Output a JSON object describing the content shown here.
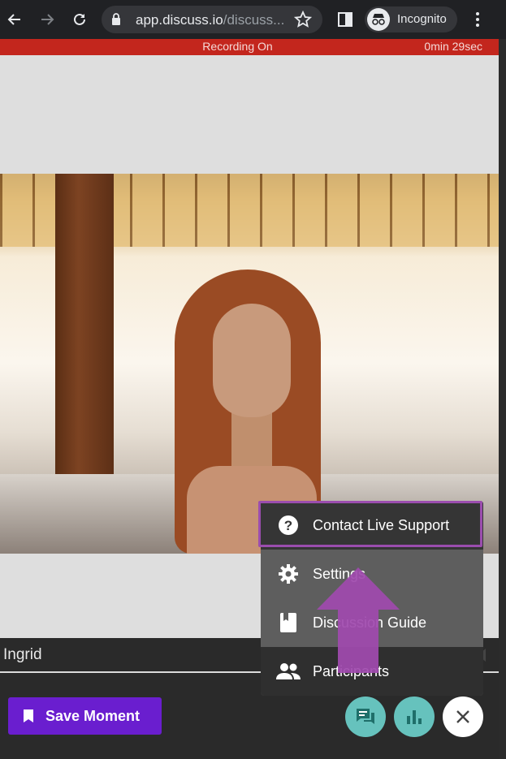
{
  "browser": {
    "url_host": "app.discuss.io",
    "url_path": "/discuss...",
    "incognito_label": "Incognito"
  },
  "recording": {
    "status": "Recording On",
    "timer": "0min 29sec",
    "color": "#c3261d"
  },
  "participant": {
    "name": "Ingrid"
  },
  "menu": {
    "items": [
      {
        "label": "Contact Live Support",
        "icon": "help-circle-icon"
      },
      {
        "label": "Settings",
        "icon": "gear-icon"
      },
      {
        "label": "Discussion Guide",
        "icon": "book-icon"
      },
      {
        "label": "Participants",
        "icon": "people-icon"
      }
    ]
  },
  "toolbar": {
    "save_label": "Save Moment",
    "accent": "#6a1ecf",
    "teal": "#66c2bd"
  },
  "annotation": {
    "highlight_color": "#9b4dae"
  }
}
